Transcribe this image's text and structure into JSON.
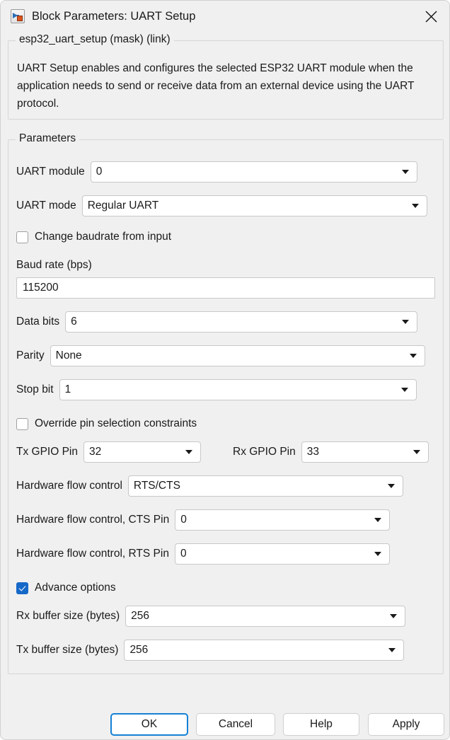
{
  "window": {
    "title": "Block Parameters: UART Setup",
    "icon": "simulink-block-icon",
    "close_icon": "close-icon"
  },
  "description": {
    "legend": "esp32_uart_setup (mask) (link)",
    "text": "UART Setup enables and configures the selected ESP32 UART module when the application needs to send or receive data from an external device using the UART protocol."
  },
  "parameters": {
    "legend": "Parameters",
    "uart_module": {
      "label": "UART module",
      "value": "0"
    },
    "uart_mode": {
      "label": "UART mode",
      "value": "Regular UART"
    },
    "change_baudrate": {
      "label": "Change baudrate from input",
      "checked": false
    },
    "baud_rate": {
      "label": "Baud rate (bps)",
      "value": "115200"
    },
    "data_bits": {
      "label": "Data bits",
      "value": "6"
    },
    "parity": {
      "label": "Parity",
      "value": "None"
    },
    "stop_bit": {
      "label": "Stop bit",
      "value": "1"
    },
    "override_pins": {
      "label": "Override pin selection constraints",
      "checked": false
    },
    "tx_gpio_pin": {
      "label": "Tx GPIO Pin",
      "value": "32"
    },
    "rx_gpio_pin": {
      "label": "Rx GPIO Pin",
      "value": "33"
    },
    "hw_flow_control": {
      "label": "Hardware flow control",
      "value": "RTS/CTS"
    },
    "hw_flow_cts_pin": {
      "label": "Hardware flow control, CTS Pin",
      "value": "0"
    },
    "hw_flow_rts_pin": {
      "label": "Hardware flow control, RTS Pin",
      "value": "0"
    },
    "advance_options": {
      "label": "Advance options",
      "checked": true
    },
    "rx_buffer_size": {
      "label": "Rx buffer size (bytes)",
      "value": "256"
    },
    "tx_buffer_size": {
      "label": "Tx buffer size (bytes)",
      "value": "256"
    }
  },
  "buttons": {
    "ok": "OK",
    "cancel": "Cancel",
    "help": "Help",
    "apply": "Apply"
  },
  "colors": {
    "dialog_background": "#f0f0f0",
    "field_background": "#ffffff",
    "checkbox_checked": "#1668c8",
    "focus_ring": "#1581d6",
    "text": "#1a1a1a"
  }
}
